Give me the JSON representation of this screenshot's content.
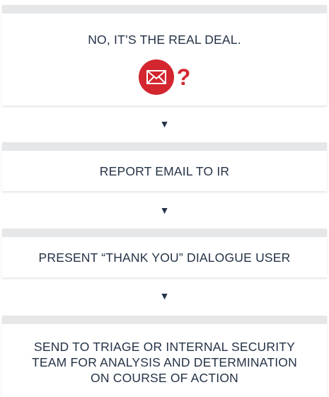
{
  "steps": [
    {
      "label": "NO, IT’S THE REAL DEAL."
    },
    {
      "label": "REPORT EMAIL TO IR"
    },
    {
      "label": "PRESENT “THANK YOU” DIALOGUE USER"
    },
    {
      "label": "SEND TO TRIAGE OR INTERNAL SECURITY",
      "line2": "TEAM FOR ANALYSIS AND DETERMINATION",
      "line3": "ON COURSE OF ACTION"
    }
  ],
  "icon": {
    "name": "envelope-icon",
    "mark": "?",
    "color": "#d3262f"
  },
  "arrow_glyph": "▼",
  "colors": {
    "text": "#253347",
    "card_top": "#e5e7e9",
    "accent": "#d3262f"
  }
}
